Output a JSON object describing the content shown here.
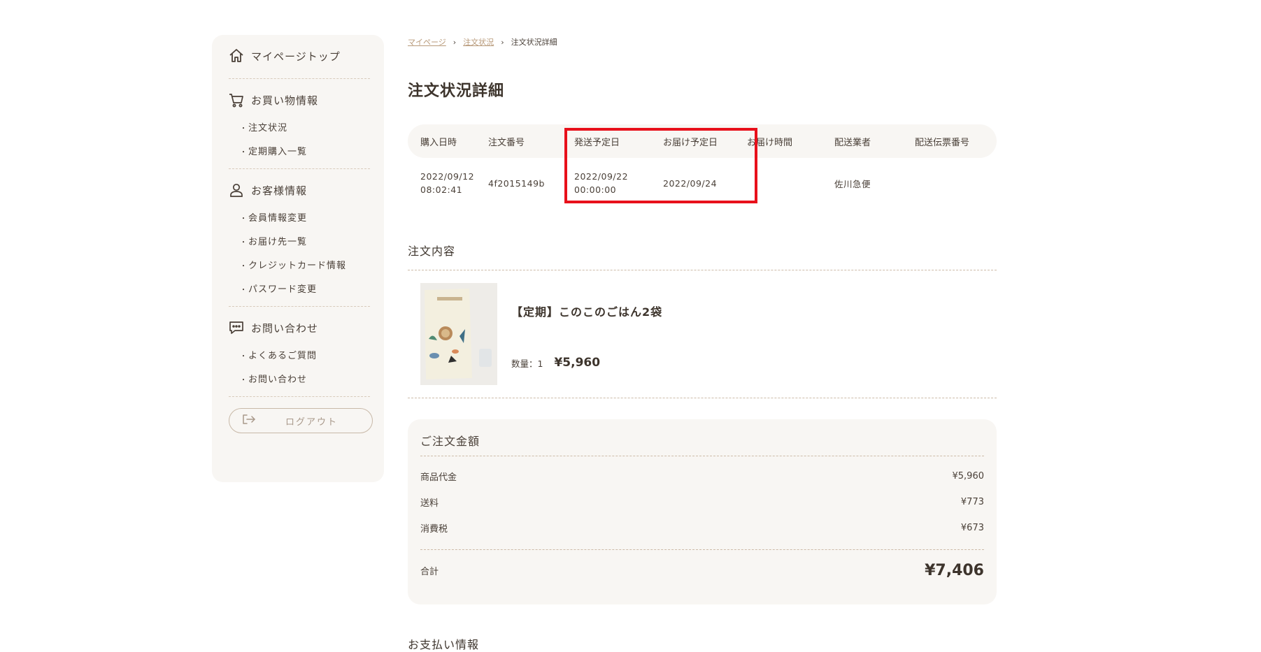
{
  "sidebar": {
    "top_label": "マイページトップ",
    "shopping": {
      "title": "お買い物情報",
      "items": [
        "注文状況",
        "定期購入一覧"
      ]
    },
    "customer": {
      "title": "お客様情報",
      "items": [
        "会員情報変更",
        "お届け先一覧",
        "クレジットカード情報",
        "パスワード変更"
      ]
    },
    "contact": {
      "title": "お問い合わせ",
      "items": [
        "よくあるご質問",
        "お問い合わせ"
      ]
    },
    "bullet": "・",
    "logout_label": "ログアウト"
  },
  "breadcrumb": {
    "home": "マイページ",
    "orders": "注文状況",
    "current": "注文状況詳細",
    "separator": "›"
  },
  "page_title": "注文状況詳細",
  "order_table": {
    "headers": [
      "購入日時",
      "注文番号",
      "発送予定日",
      "お届け予定日",
      "お届け時間",
      "配送業者",
      "配送伝票番号"
    ],
    "row": {
      "purchase_date": "2022/09/12",
      "purchase_time": "08:02:41",
      "order_no": "4f2015149b",
      "ship_date": "2022/09/22",
      "ship_time": "00:00:00",
      "delivery_date": "2022/09/24",
      "delivery_time": "",
      "carrier": "佐川急便",
      "slip_no": ""
    },
    "highlight_color": "#e8101b"
  },
  "order_contents": {
    "title": "注文内容",
    "item": {
      "name": "【定期】このこのごはん2袋",
      "qty_label": "数量：1",
      "price": "¥5,960"
    }
  },
  "totals": {
    "title": "ご注文金額",
    "rows": [
      {
        "label": "商品代金",
        "value": "¥5,960"
      },
      {
        "label": "送料",
        "value": "¥773"
      },
      {
        "label": "消費税",
        "value": "¥673"
      }
    ],
    "sum_label": "合計",
    "sum_value": "¥7,406"
  },
  "payment": {
    "title": "お支払い情報"
  },
  "colors": {
    "panel_bg": "#f8f6f3",
    "accent_link": "#b89a7a",
    "text": "#4a4038"
  }
}
